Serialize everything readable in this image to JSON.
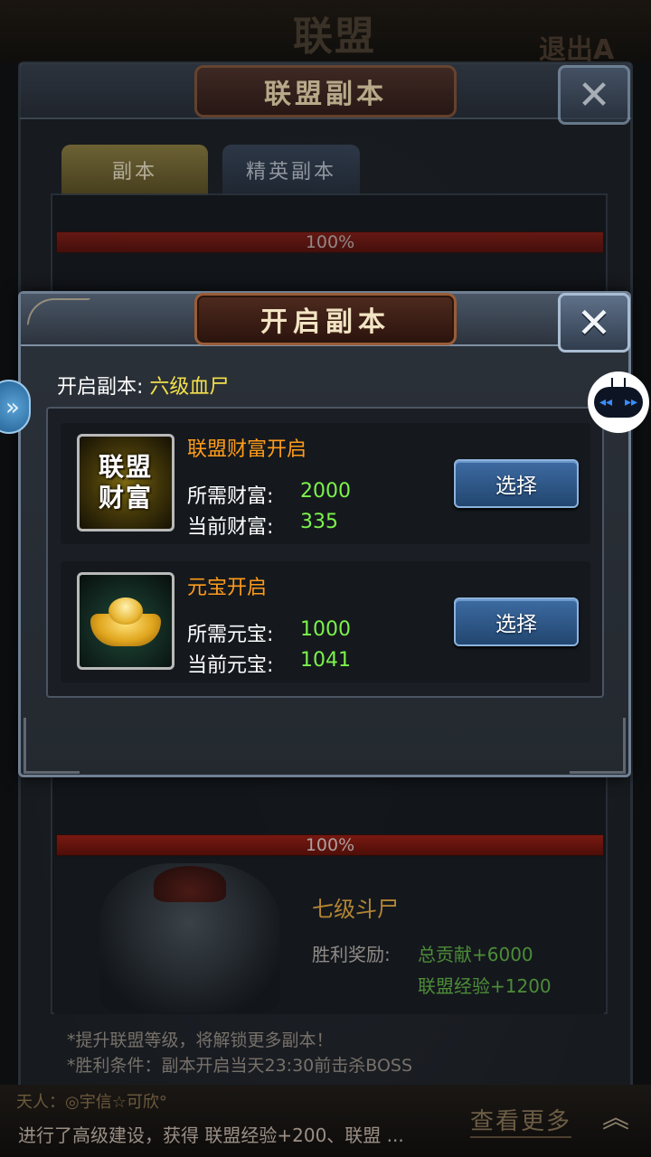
{
  "background": {
    "title": "联盟",
    "exit_text": "退出A",
    "back_panel_title": "联盟副本",
    "back_close_symbol": "✕",
    "tabs": [
      "副本",
      "精英副本"
    ],
    "hp_bar_top": "100%",
    "hp_bar_bottom": "100%",
    "boss": {
      "name": "七级斗尸",
      "reward_label": "胜利奖励:",
      "reward_1": "总贡献+6000",
      "reward_2": "联盟经验+1200"
    },
    "notes": [
      "*提升联盟等级，将解锁更多副本！",
      "*胜利条件：副本开启当天23:30前击杀BOSS"
    ],
    "chat_line_1": "天人：◎宇信☆可欣°",
    "chat_line_2": "进行了高级建设，获得 联盟经验+200、联盟 ...",
    "see_more": "查看更多",
    "up_arrow": "︽"
  },
  "dialog": {
    "title": "开启副本",
    "close_symbol": "✕",
    "open_label": "开启副本:",
    "open_value": "六级血尸",
    "options": [
      {
        "icon_text_line1": "联盟",
        "icon_text_line2": "财富",
        "title": "联盟财富开启",
        "required_label": "所需财富:",
        "required_value": "2000",
        "current_label": "当前财富:",
        "current_value": "335",
        "button": "选择"
      },
      {
        "icon": "gold-ingot-icon",
        "title": "元宝开启",
        "required_label": "所需元宝:",
        "required_value": "1000",
        "current_label": "当前元宝:",
        "current_value": "1041",
        "button": "选择"
      }
    ]
  },
  "widgets": {
    "left_arrow": "»",
    "float_left": "◂◂",
    "float_right": "▸▸"
  },
  "colors": {
    "title_gold": "#f2e4c4",
    "option_title": "#ff9c1a",
    "value_green": "#7cf24a",
    "highlight_yellow": "#f3e04a",
    "button_blue": "#3d6ba3"
  }
}
